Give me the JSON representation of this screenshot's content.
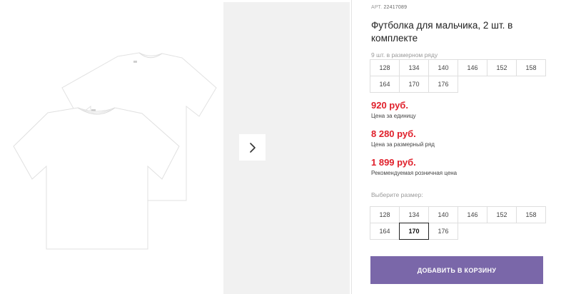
{
  "product": {
    "article_label": "АРТ.",
    "article_number": "22417089",
    "title": "Футболка для мальчика, 2 шт. в комплекте"
  },
  "size_series": {
    "label": "9 шт. в размерном ряду",
    "sizes": [
      "128",
      "134",
      "140",
      "146",
      "152",
      "158",
      "164",
      "170",
      "176"
    ]
  },
  "prices": {
    "unit_price": "920 руб.",
    "unit_caption": "Цена за единицу",
    "series_price": "8 280 руб.",
    "series_caption": "Цена за размерный ряд",
    "retail_price": "1 899 руб.",
    "retail_caption": "Рекомендуемая розничная цена"
  },
  "size_select": {
    "label": "Выберите размер:",
    "sizes": [
      "128",
      "134",
      "140",
      "146",
      "152",
      "158",
      "164",
      "170",
      "176"
    ],
    "selected": "170"
  },
  "cart": {
    "button_label": "ДОБАВИТЬ В КОРЗИНУ"
  },
  "gallery": {
    "next_icon": "chevron-right-icon"
  },
  "colors": {
    "price": "#e0202b",
    "button": "#7a67a9"
  }
}
